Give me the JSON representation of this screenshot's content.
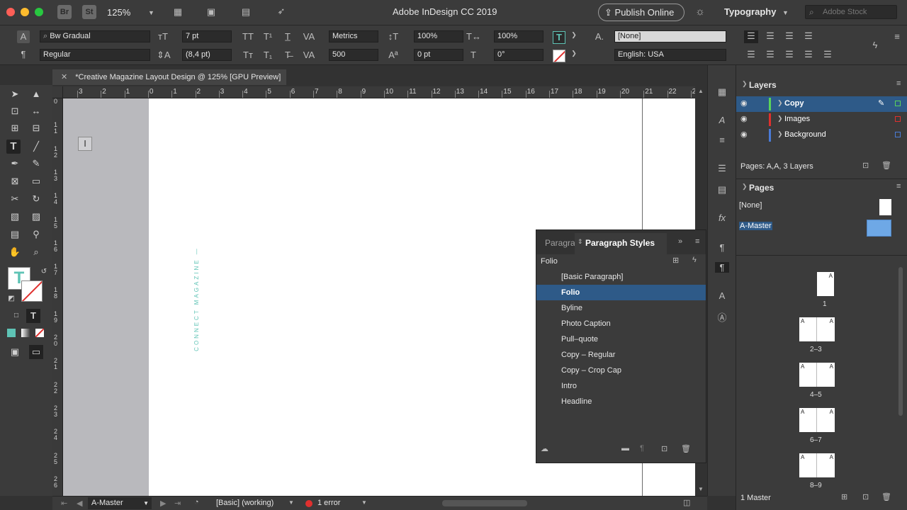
{
  "app": {
    "title": "Adobe InDesign CC 2019",
    "zoom": "125%",
    "publish_label": "Publish Online",
    "workspace": "Typography",
    "stock_placeholder": "Adobe Stock"
  },
  "control": {
    "font_family": "Bw Gradual",
    "font_style": "Regular",
    "font_size": "7 pt",
    "leading": "(8,4 pt)",
    "kerning": "Metrics",
    "tracking": "500",
    "vscale": "100%",
    "hscale": "100%",
    "baseline": "0 pt",
    "skew": "0°",
    "char_style": "[None]",
    "language": "English: USA"
  },
  "document": {
    "tab_title": "*Creative Magazine Layout Design @ 125% [GPU Preview]",
    "vertical_text": "CONNECT MAGAZINE —"
  },
  "rulers": {
    "h": [
      "3",
      "2",
      "1",
      "0",
      "1",
      "2",
      "3",
      "4",
      "5",
      "6",
      "7",
      "8",
      "9",
      "10",
      "11",
      "12",
      "13",
      "14",
      "15",
      "16",
      "17",
      "18",
      "19",
      "20",
      "21",
      "22",
      "2"
    ],
    "v": [
      "0",
      "1\n1",
      "1\n2",
      "1\n3",
      "1\n4",
      "1\n5",
      "1\n6",
      "1\n7",
      "1\n8",
      "1\n9",
      "2\n0",
      "2\n1",
      "2\n2",
      "2\n3",
      "2\n4",
      "2\n5",
      "2\n6"
    ]
  },
  "status": {
    "page": "A-Master",
    "preflight_profile": "[Basic] (working)",
    "errors": "1 error"
  },
  "layers": {
    "title": "Layers",
    "items": [
      {
        "name": "Copy",
        "color": "#5ad35a",
        "selected": true
      },
      {
        "name": "Images",
        "color": "#e0302e",
        "selected": false
      },
      {
        "name": "Background",
        "color": "#4a7bd6",
        "selected": false
      }
    ],
    "footer": "Pages: A,A, 3 Layers"
  },
  "pages": {
    "title": "Pages",
    "none_label": "[None]",
    "master_label": "A-Master",
    "spreads": [
      "1",
      "2–3",
      "4–5",
      "6–7",
      "8–9"
    ],
    "footer": "1 Master"
  },
  "paragraph_styles": {
    "tab_inactive": "Paragra",
    "tab_active": "Paragraph Styles",
    "current": "Folio",
    "items": [
      "[Basic Paragraph]",
      "Folio",
      "Byline",
      "Photo Caption",
      "Pull–quote",
      "Copy – Regular",
      "Copy – Crop Cap",
      "Intro",
      "Headline"
    ],
    "selected_index": 1
  },
  "colors": {
    "accent": "#2e5a88",
    "teal": "#5ec3b5",
    "page": "#ffffff",
    "pasteboard": "#b9b9bd"
  }
}
